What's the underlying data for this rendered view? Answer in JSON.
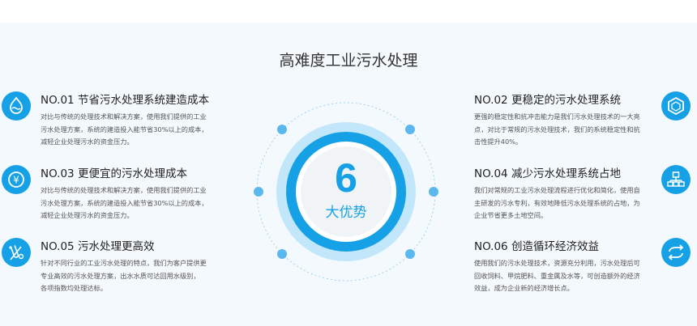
{
  "section": {
    "title": "高难度工业污水处理"
  },
  "center": {
    "number": "6",
    "label": "大优势"
  },
  "advantages": [
    {
      "title": "NO.01 节省污水处理系统建造成本",
      "lines": [
        "对比与传统的处理技术和解决方案，使用我们提供的工业",
        "污水处理方案，系统的建造投入能节省30%以上的成本，",
        "减轻企业处理污水的资金压力。"
      ],
      "icon": "water-drop-icon"
    },
    {
      "title": "NO.02 更稳定的污水处理系统",
      "lines": [
        "更强的稳定性和抗冲击能力是我们污水处理技术的一大亮",
        "点，对比于常规的污水处理技术，我们的系统稳定性和抗",
        "击性提升40%。"
      ],
      "icon": "hexagon-cube-icon"
    },
    {
      "title": "NO.03 更便宜的污水处理成本",
      "lines": [
        "对比与传统的处理技术和解决方案，使用我们提供的工业",
        "污水处理方案，系统的建造投入能节省30%以上的成本，",
        "减轻企业处理污水的资金压力。"
      ],
      "icon": "yen-icon"
    },
    {
      "title": "NO.04 减少污水处理系统占地",
      "lines": [
        "我们对常规的工业污水处理流程进行优化和简化，使用自",
        "主研发的污水专利，有效地降低污水处理系统的占地，为",
        "企业节省更多土地空间。"
      ],
      "icon": "org-chart-icon"
    },
    {
      "title": "NO.05 污水处理更高效",
      "lines": [
        "针对不同行业的工业污水处理的特点，我们为客户提供更",
        "专业高效的污水处理方案，出水水质可达回用水级别，",
        "各项指数均处理达标。"
      ],
      "icon": "lab-tube-icon"
    },
    {
      "title": "NO.06 创造循环经济效益",
      "lines": [
        "使用我们的污水处理技术，资源充分利用，污水处理后可",
        "回收饲料、甲烷肥料、重金属及水等，可创造额外的经济",
        "效益，成为企业新的经济增长点。"
      ],
      "icon": "cycle-arrows-icon"
    }
  ],
  "colors": {
    "accent": "#16a1e7",
    "ring": "#bfe6fa",
    "dot": "#5bb8ef"
  }
}
